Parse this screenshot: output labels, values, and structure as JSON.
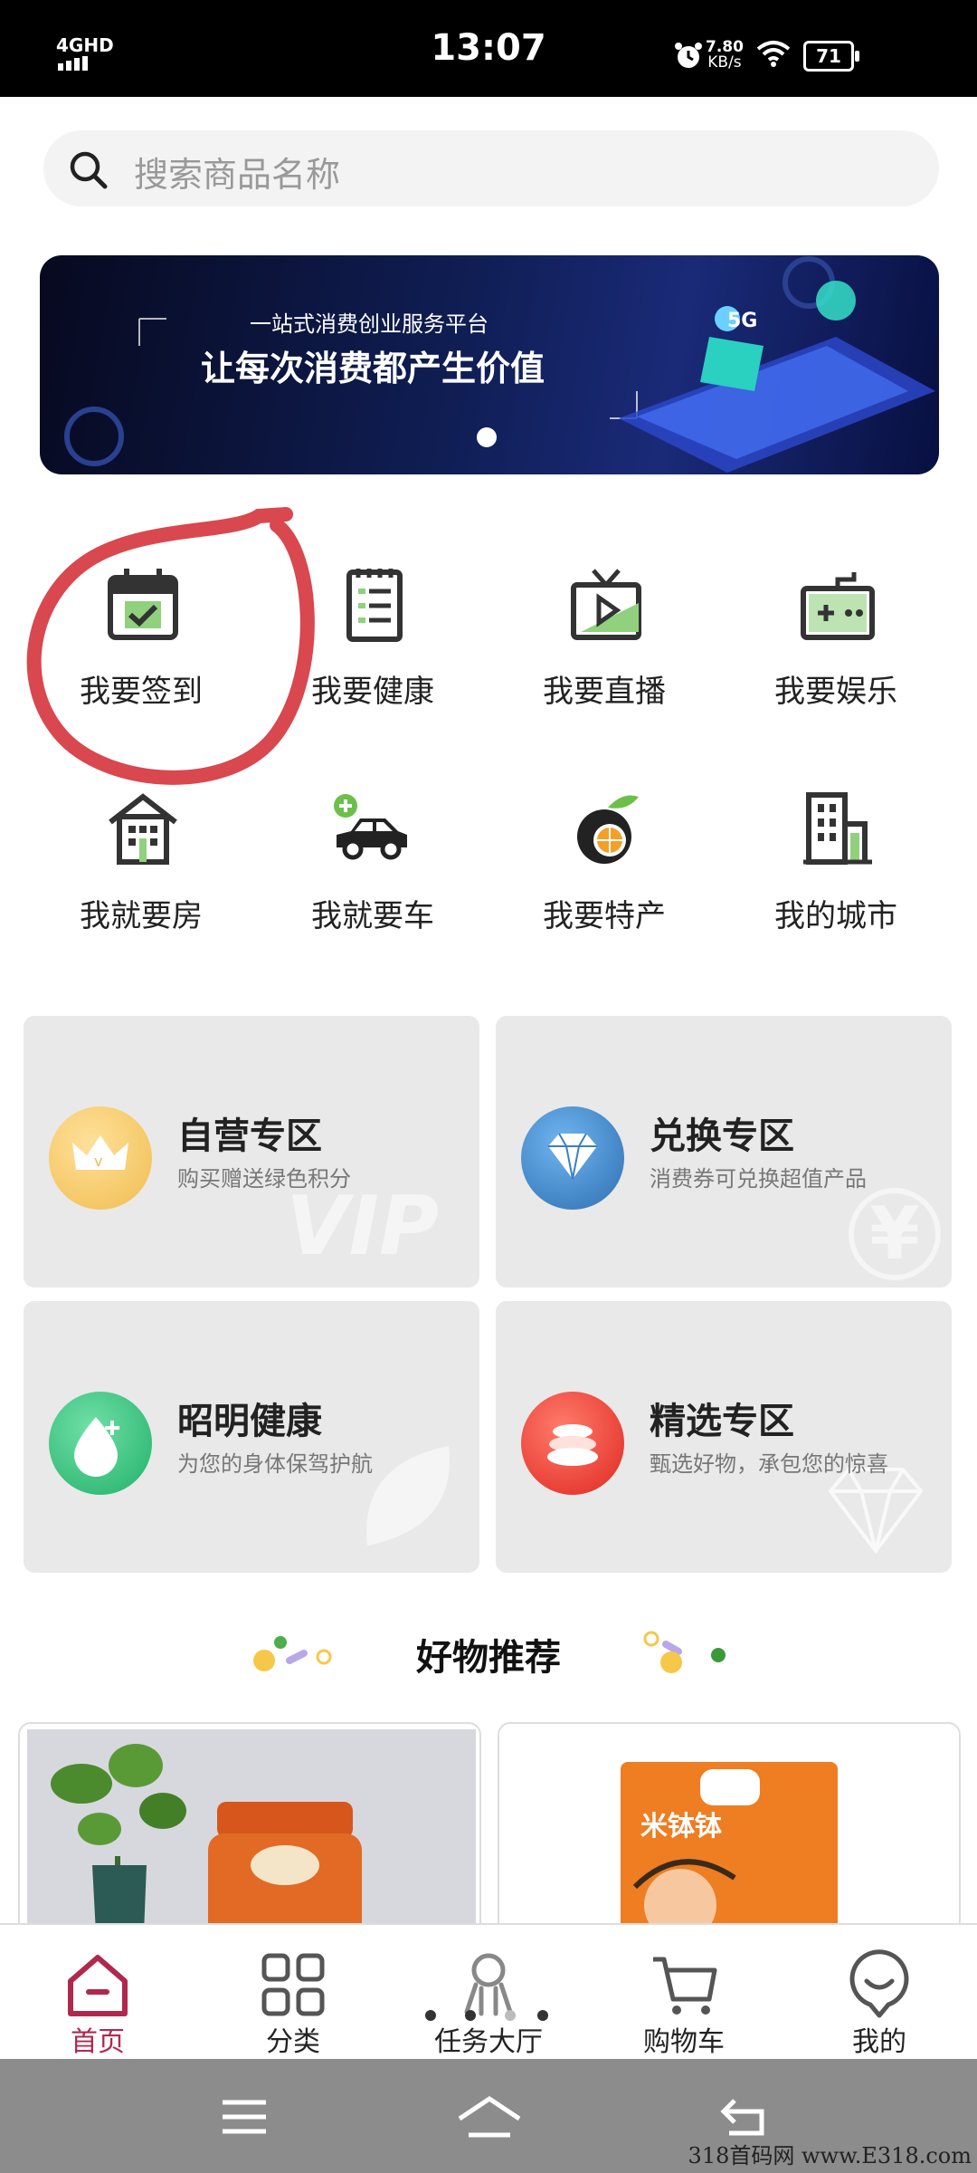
{
  "status_bar": {
    "network": "4GHD",
    "time": "13:07",
    "speed_value": "7.80",
    "speed_unit": "KB/s",
    "battery": "71"
  },
  "search": {
    "placeholder": "搜索商品名称"
  },
  "banner": {
    "subtitle": "一站式消费创业服务平台",
    "title": "让每次消费都产生价值",
    "badge": "5G"
  },
  "quick_menu": [
    {
      "label": "我要签到",
      "icon": "calendar-check-icon"
    },
    {
      "label": "我要健康",
      "icon": "clipboard-list-icon"
    },
    {
      "label": "我要直播",
      "icon": "tv-play-icon"
    },
    {
      "label": "我要娱乐",
      "icon": "gamepad-icon"
    },
    {
      "label": "我就要房",
      "icon": "building-icon"
    },
    {
      "label": "我就要车",
      "icon": "car-icon"
    },
    {
      "label": "我要特产",
      "icon": "orange-fruit-icon"
    },
    {
      "label": "我的城市",
      "icon": "city-icon"
    }
  ],
  "zones": [
    {
      "title": "自营专区",
      "desc": "购买赠送绿色积分",
      "icon": "crown-icon",
      "watermark": "VIP",
      "color": "#f0bd4f"
    },
    {
      "title": "兑换专区",
      "desc": "消费券可兑换超值产品",
      "icon": "diamond-icon",
      "watermark": "¥",
      "color": "#3b7fc4"
    },
    {
      "title": "昭明健康",
      "desc": "为您的身体保驾护航",
      "icon": "water-drop-icon",
      "color": "#2ec27e"
    },
    {
      "title": "精选专区",
      "desc": "甄选好物，承包您的惊喜",
      "icon": "coins-icon",
      "color": "#e8322c"
    }
  ],
  "recommend": {
    "title": "好物推荐",
    "product_2_brand": "米钵钵"
  },
  "tabbar": [
    {
      "label": "首页",
      "icon": "home-icon",
      "active": true
    },
    {
      "label": "分类",
      "icon": "grid-icon",
      "active": false
    },
    {
      "label": "任务大厅",
      "icon": "task-icon",
      "active": false
    },
    {
      "label": "购物车",
      "icon": "cart-icon",
      "active": false
    },
    {
      "label": "我的",
      "icon": "smile-icon",
      "active": false
    }
  ],
  "theme": {
    "accent": "#b0284f",
    "annotation_circle": "#d9474f"
  },
  "watermark": "318首码网 www.E318.com"
}
